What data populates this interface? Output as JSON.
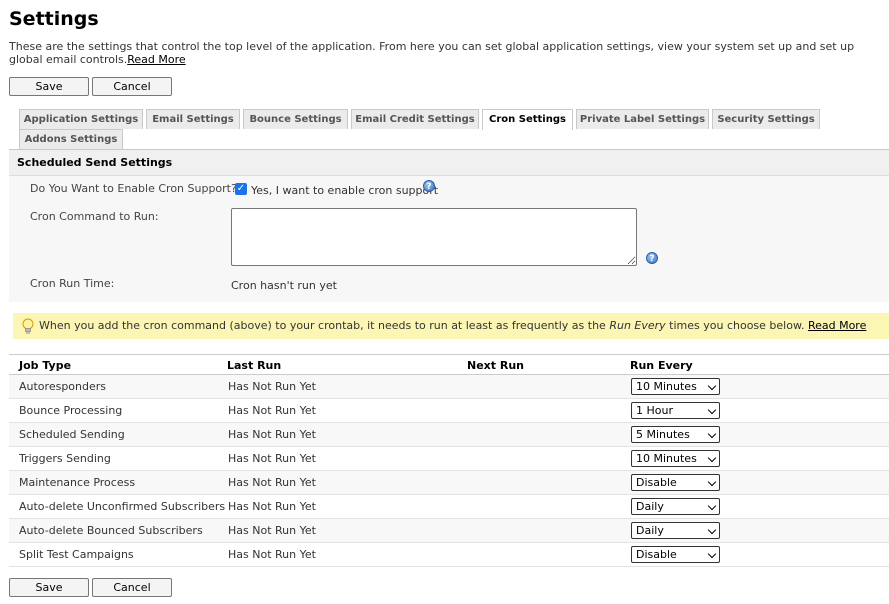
{
  "page": {
    "title": "Settings",
    "intro": "These are the settings that control the top level of the application. From here you can set global application settings, view your system set up and set up global email controls.",
    "intro_link": "Read More"
  },
  "buttons": {
    "save": "Save",
    "cancel": "Cancel"
  },
  "tabs": [
    {
      "label": "Application Settings",
      "active": false
    },
    {
      "label": "Email Settings",
      "active": false
    },
    {
      "label": "Bounce Settings",
      "active": false
    },
    {
      "label": "Email Credit Settings",
      "active": false
    },
    {
      "label": "Cron Settings",
      "active": true
    },
    {
      "label": "Private Label Settings",
      "active": false
    },
    {
      "label": "Security Settings",
      "active": false
    },
    {
      "label": "Addons Settings",
      "active": false
    }
  ],
  "section": {
    "title": "Scheduled Send Settings",
    "enable_label": "Do You Want to Enable Cron Support?",
    "enable_checkbox_label": "Yes, I want to enable cron support",
    "enable_checked": true,
    "command_label": "Cron Command to Run:",
    "command_value": "",
    "run_time_label": "Cron Run Time:",
    "run_time_value": "Cron hasn't run yet"
  },
  "note": {
    "text_before": "When you add the cron command (above) to your crontab, it needs to run at least as frequently as the ",
    "text_em": "Run Every",
    "text_after": " times you choose below. ",
    "link": "Read More"
  },
  "jobs": {
    "headers": {
      "job_type": "Job Type",
      "last_run": "Last Run",
      "next_run": "Next Run",
      "run_every": "Run Every"
    },
    "rows": [
      {
        "job": "Autoresponders",
        "last_run": "Has Not Run Yet",
        "next_run": "",
        "run_every": "10 Minutes"
      },
      {
        "job": "Bounce Processing",
        "last_run": "Has Not Run Yet",
        "next_run": "",
        "run_every": "1 Hour"
      },
      {
        "job": "Scheduled Sending",
        "last_run": "Has Not Run Yet",
        "next_run": "",
        "run_every": "5 Minutes"
      },
      {
        "job": "Triggers Sending",
        "last_run": "Has Not Run Yet",
        "next_run": "",
        "run_every": "10 Minutes"
      },
      {
        "job": "Maintenance Process",
        "last_run": "Has Not Run Yet",
        "next_run": "",
        "run_every": "Disable"
      },
      {
        "job": "Auto-delete Unconfirmed Subscribers",
        "last_run": "Has Not Run Yet",
        "next_run": "",
        "run_every": "Daily"
      },
      {
        "job": "Auto-delete Bounced Subscribers",
        "last_run": "Has Not Run Yet",
        "next_run": "",
        "run_every": "Daily"
      },
      {
        "job": "Split Test Campaigns",
        "last_run": "Has Not Run Yet",
        "next_run": "",
        "run_every": "Disable"
      }
    ]
  },
  "icons": {
    "help": "help-icon",
    "note": "lightbulb-icon",
    "dropdown": "chevron-down-icon"
  },
  "colors": {
    "note_bg": "#fbf6b4",
    "checkbox": "#1a73e8",
    "help": "#3b77c2"
  }
}
